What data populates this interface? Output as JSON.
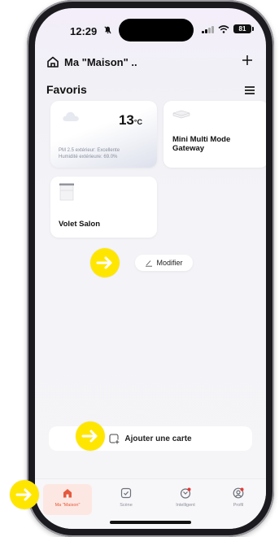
{
  "status_bar": {
    "time": "12:29",
    "battery": "81"
  },
  "header": {
    "title": "Ma \"Maison\" ..",
    "add_icon": "plus-icon",
    "home_icon": "home-icon"
  },
  "favorites": {
    "title": "Favoris",
    "menu_icon": "menu-icon"
  },
  "cards": {
    "weather": {
      "temperature": "13",
      "unit": "°C",
      "pm25": "PM 2.5 extérieur: Excellente",
      "humidity": "Humidité extérieure: 69.0%",
      "icon": "cloud-icon"
    },
    "gateway": {
      "name": "Mini Multi Mode Gateway",
      "icon": "gateway-device-icon"
    },
    "volet": {
      "name": "Volet Salon",
      "icon": "blind-icon"
    }
  },
  "actions": {
    "modify_label": "Modifier",
    "add_card_label": "Ajouter une carte"
  },
  "tabbar": {
    "tabs": [
      {
        "label": "Ma \"Maison\"",
        "icon": "home-tab-icon",
        "active": true
      },
      {
        "label": "Scène",
        "icon": "scene-tab-icon",
        "active": false
      },
      {
        "label": "Intelligent",
        "icon": "intelligent-tab-icon",
        "active": false
      },
      {
        "label": "Profil",
        "icon": "profile-tab-icon",
        "active": false
      }
    ]
  },
  "colors": {
    "accent": "#e45a3d",
    "highlight_arrow": "#ffe600",
    "notification_dot": "#e53935"
  }
}
